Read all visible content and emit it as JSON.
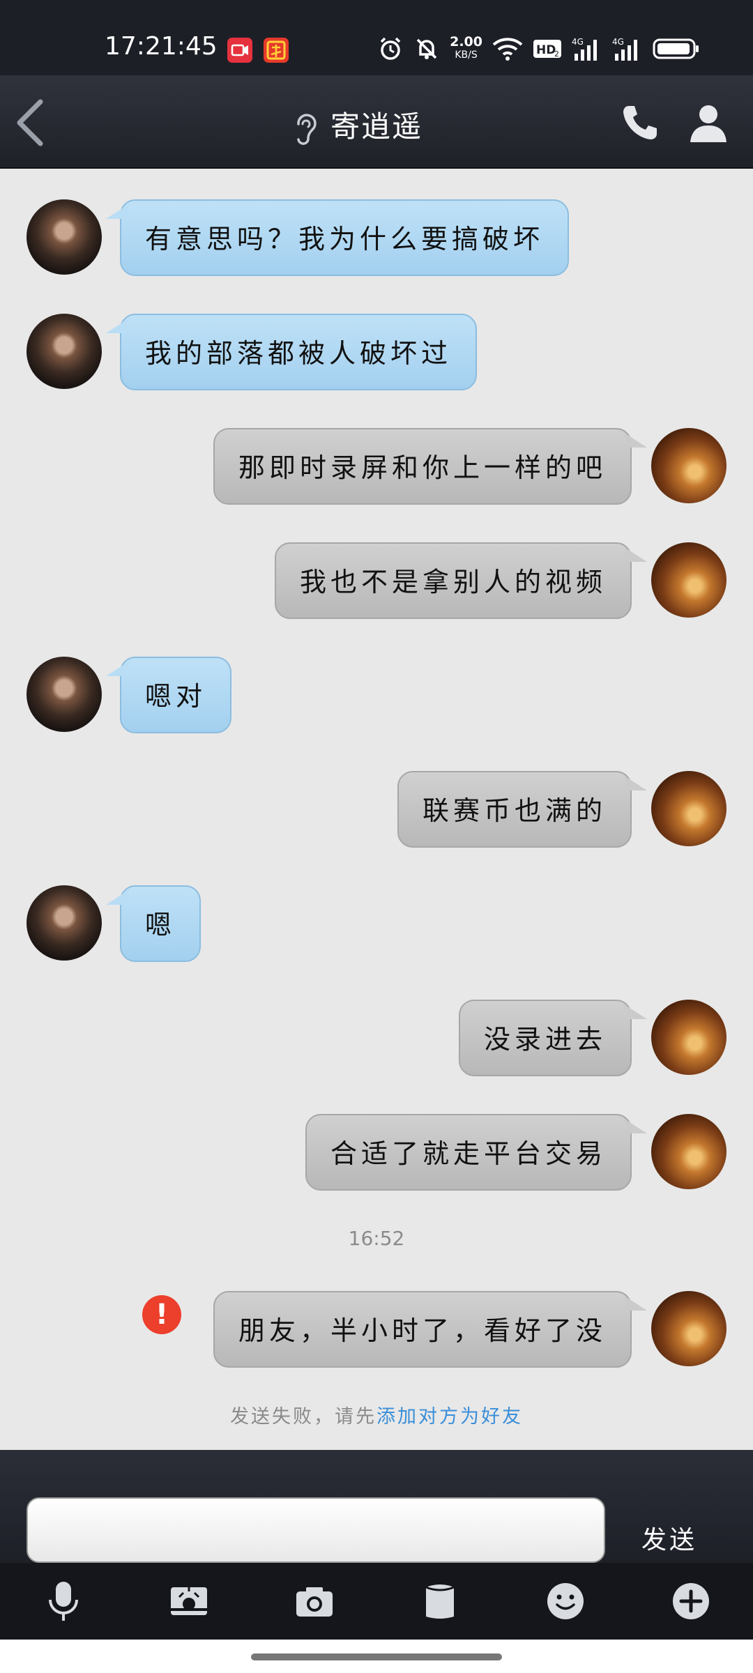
{
  "status_bar": {
    "time": "17:21:45",
    "net_speed": "2.00",
    "net_speed_unit": "KB/S",
    "icons": [
      "screen-record-icon",
      "app-notification-icon",
      "alarm-icon",
      "mute-icon",
      "wifi-icon",
      "hd-icon",
      "signal-4g-icon",
      "signal-4g-icon",
      "battery-icon"
    ]
  },
  "header": {
    "title": "寄逍遥",
    "icons": [
      "back-icon",
      "ear-icon",
      "phone-icon",
      "profile-icon"
    ]
  },
  "messages": [
    {
      "side": "them",
      "text": "有意思吗？我为什么要搞破坏"
    },
    {
      "side": "them",
      "text": "我的部落都被人破坏过"
    },
    {
      "side": "me",
      "text": "那即时录屏和你上一样的吧"
    },
    {
      "side": "me",
      "text": "我也不是拿别人的视频"
    },
    {
      "side": "them",
      "text": "嗯对"
    },
    {
      "side": "me",
      "text": "联赛币也满的"
    },
    {
      "side": "them",
      "text": "嗯"
    },
    {
      "side": "me",
      "text": "没录进去"
    },
    {
      "side": "me",
      "text": "合适了就走平台交易"
    },
    {
      "side": "me",
      "text": "朋友，半小时了，看好了没",
      "status": "failed"
    }
  ],
  "timestamp": "16:52",
  "fail_notice": {
    "prefix": "发送失败，请先",
    "link": "添加对方为好友"
  },
  "input": {
    "value": "",
    "send_label": "发送"
  },
  "toolbar": {
    "items": [
      "microphone-icon",
      "photo-icon",
      "camera-icon",
      "file-icon",
      "emoji-icon",
      "plus-icon"
    ]
  },
  "colors": {
    "incoming_bubble": "#a3d0ef",
    "outgoing_bubble": "#b8b8b8",
    "error": "#ec3f2c",
    "link": "#3a8ed9",
    "chat_background": "#e8e8e8",
    "header_background": "#1f2128"
  }
}
